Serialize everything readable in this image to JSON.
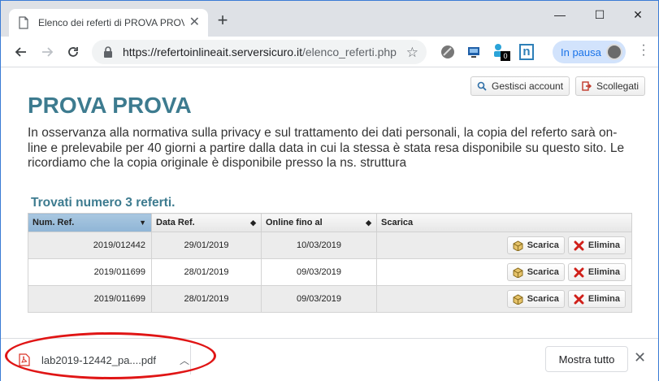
{
  "browser": {
    "tab_title": "Elenco dei referti di PROVA PROVA",
    "tab_close": "✕",
    "new_tab": "+",
    "window_controls": {
      "minimize": "—",
      "maximize": "☐",
      "close": "✕"
    },
    "url_host": "https://refertoinlineait.serversicuro.it",
    "url_path": "/elenco_referti.php",
    "bookmark_star": "☆",
    "extension_badge": "0",
    "extension_n": "n",
    "profile_label": "In pausa"
  },
  "page": {
    "account_button": "Gestisci account",
    "logout_button": "Scollegati",
    "title": "PROVA PROVA",
    "intro": "In osservanza alla normativa sulla privacy e sul trattamento dei dati personali, la copia del referto sarà on-line e prelevabile per 40 giorni a partire dalla data in cui la stessa è stata resa disponibile su questo sito. Le ricordiamo che la copia originale è disponibile presso la ns. struttura",
    "found_text": "Trovati numero 3 referti.",
    "table": {
      "headers": [
        "Num. Ref.",
        "Data Ref.",
        "Online fino al",
        "Scarica"
      ],
      "rows": [
        {
          "num": "2019/012442",
          "date": "29/01/2019",
          "online": "10/03/2019"
        },
        {
          "num": "2019/011699",
          "date": "28/01/2019",
          "online": "09/03/2019"
        },
        {
          "num": "2019/011699",
          "date": "28/01/2019",
          "online": "09/03/2019"
        }
      ],
      "download_label": "Scarica",
      "delete_label": "Elimina"
    }
  },
  "download_bar": {
    "file_name": "lab2019-12442_pa....pdf",
    "show_all": "Mostra tutto",
    "close": "✕"
  },
  "colors": {
    "accent": "#3d7b8f",
    "annotation": "#e01515",
    "profile_bg": "#d2e3fc"
  }
}
